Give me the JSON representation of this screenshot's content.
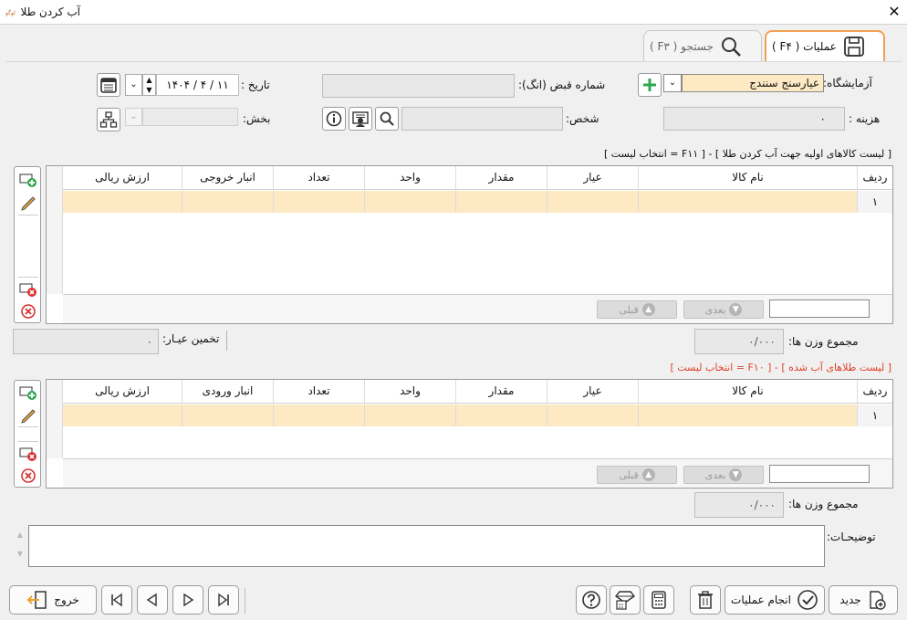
{
  "window": {
    "title": "آب کردن طلا",
    "close_glyph": "✕"
  },
  "tabs": {
    "operations": "عملیات ( F۴ )",
    "search": "جستجو ( F۳ )"
  },
  "form": {
    "lab_label": "آزمایشگاه:",
    "lab_value": "عیارسنج سنندج",
    "receipt_label": "شماره قبض (انگ):",
    "receipt_value": "",
    "date_label": "تاریخ :",
    "date_value": "۱۱ / ۴ / ۱۴۰۴",
    "cost_label": "هزینه :",
    "cost_value": "۰",
    "person_label": "شخص:",
    "person_value": "",
    "section_label": "بخش:",
    "section_value": ""
  },
  "grid1": {
    "title": "[ لیست کالاهای اولیه جهت آب کردن طلا ] - [ F۱۱ = انتخاب لیست ]",
    "columns": [
      "ردیف",
      "نام کالا",
      "عیار",
      "مقدار",
      "واحد",
      "تعداد",
      "انبار خروجی",
      "ارزش ریالی"
    ],
    "rows": [
      [
        "۱",
        "",
        "",
        "",
        "",
        "",
        "",
        ""
      ]
    ],
    "next_label": "بعدی",
    "prev_label": "قبلی",
    "total_weight_label": "مجموع وزن ها:",
    "total_weight_value": "۰/۰۰۰",
    "estimate_label": "تخمین عیـار:",
    "estimate_value": "۰"
  },
  "grid2": {
    "title": "[ لیست طلاهای آب شده ] - [ F۱۰ = انتخاب لیست ]",
    "title_color": "#e0402a",
    "columns": [
      "ردیف",
      "نام کالا",
      "عیار",
      "مقدار",
      "واحد",
      "تعداد",
      "انبار ورودی",
      "ارزش ریالی"
    ],
    "rows": [
      [
        "۱",
        "",
        "",
        "",
        "",
        "",
        "",
        ""
      ]
    ],
    "next_label": "بعدی",
    "prev_label": "قبلی",
    "total_weight_label": "مجموع وزن ها:",
    "total_weight_value": "۰/۰۰۰"
  },
  "notes": {
    "label": "توضیحـات:",
    "value": ""
  },
  "toolbar": {
    "new_label": "جدید",
    "execute_label": "انجام عملیات",
    "exit_label": "خروج"
  },
  "colors": {
    "accent_orange": "#f0a050",
    "highlight_row": "#fde9c4",
    "lab_field": "#fde9c4",
    "green_plus": "#2fa84f",
    "red_delete": "#d93030"
  }
}
